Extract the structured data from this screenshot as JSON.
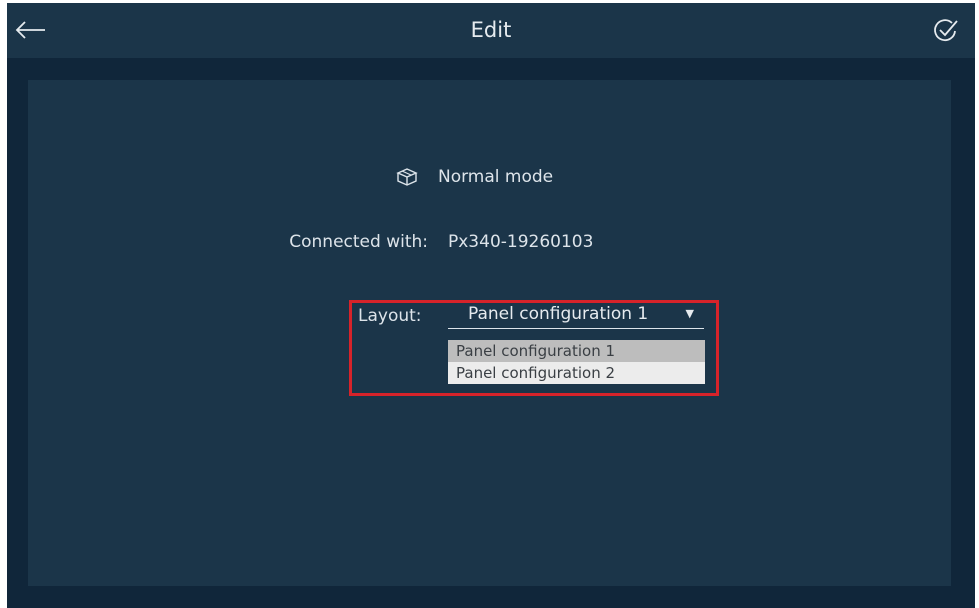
{
  "header": {
    "title": "Edit",
    "back_icon": "arrow-left-icon",
    "confirm_icon": "check-circle-icon"
  },
  "mode": {
    "icon": "box-icon",
    "label": "Normal mode"
  },
  "connection": {
    "label": "Connected with:",
    "value": "Px340-19260103"
  },
  "layout": {
    "label": "Layout:",
    "selected": "Panel configuration 1",
    "options": [
      "Panel configuration 1",
      "Panel configuration 2"
    ],
    "highlight_color": "#d7232a"
  },
  "colors": {
    "background": "#10263a",
    "panel": "#1b3549",
    "text": "#dde4ea"
  }
}
